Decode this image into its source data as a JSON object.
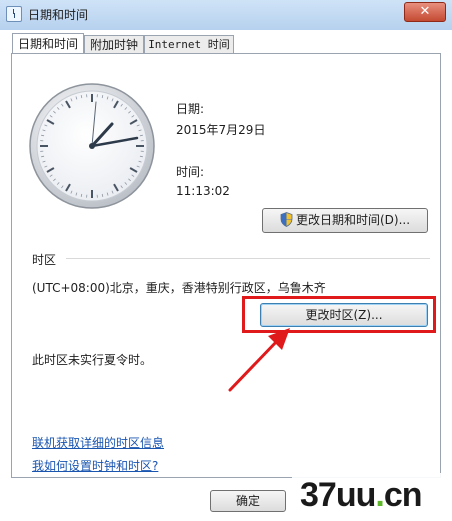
{
  "window": {
    "title": "日期和时间",
    "close_symbol": "✕"
  },
  "tabs": [
    {
      "label": "日期和时间",
      "active": true
    },
    {
      "label": "附加时钟",
      "active": false
    },
    {
      "label": "Internet 时间",
      "active": false
    }
  ],
  "datetime": {
    "date_label": "日期:",
    "date_value": "2015年7月29日",
    "time_label": "时间:",
    "time_value": "11:13:02",
    "change_button": "更改日期和时间(D)..."
  },
  "timezone": {
    "section_label": "时区",
    "current": "(UTC+08:00)北京，重庆，香港特别行政区，乌鲁木齐",
    "change_button": "更改时区(Z)...",
    "dst_note": "此时区未实行夏令时。"
  },
  "links": [
    "联机获取详细的时区信息",
    "我如何设置时钟和时区?"
  ],
  "footer": {
    "ok_button": "确定"
  },
  "watermark": {
    "text_main": "37uu",
    "text_dot": ".",
    "text_end": "cn"
  },
  "colors": {
    "highlight": "#e0191b",
    "link": "#1a55b0",
    "accent": "#3c7fb1"
  }
}
